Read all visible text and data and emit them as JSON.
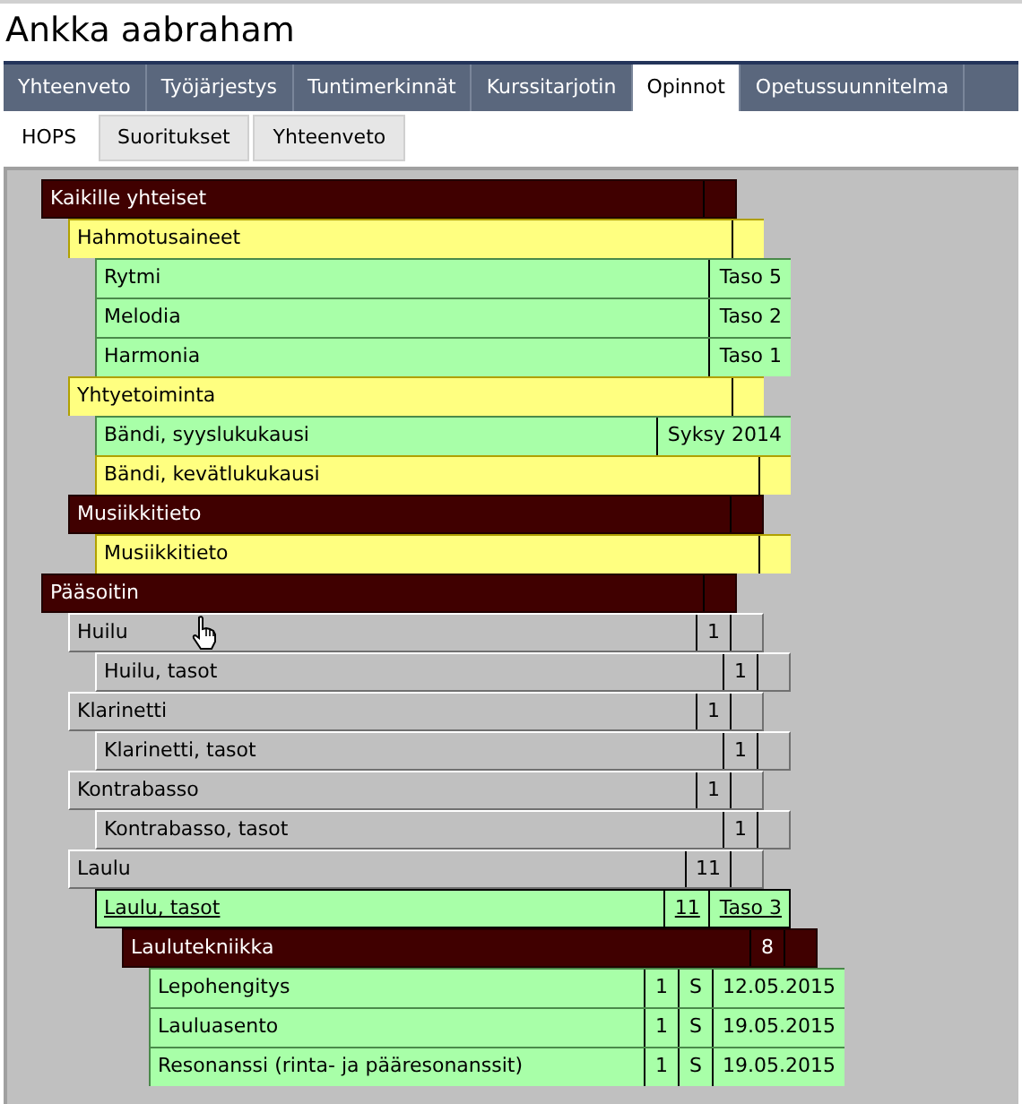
{
  "title": "Ankka aabraham",
  "tabs": [
    {
      "label": "Yhteenveto",
      "selected": false
    },
    {
      "label": "Työjärjestys",
      "selected": false
    },
    {
      "label": "Tuntimerkinnät",
      "selected": false
    },
    {
      "label": "Kurssitarjotin",
      "selected": false
    },
    {
      "label": "Opinnot",
      "selected": true
    },
    {
      "label": "Opetussuunnitelma",
      "selected": false
    }
  ],
  "subtabs": [
    {
      "label": "HOPS",
      "selected": true
    },
    {
      "label": "Suoritukset",
      "selected": false
    },
    {
      "label": "Yhteenveto",
      "selected": false
    }
  ],
  "tree": [
    {
      "label": "Kaikille yhteiset",
      "kind": "group",
      "selected": false,
      "children": [
        {
          "label": "Hahmotusaineet",
          "kind": "planned",
          "selected": false,
          "children": [
            {
              "label": "Rytmi",
              "kind": "done",
              "selected": false,
              "cells": [
                "Taso 5"
              ]
            },
            {
              "label": "Melodia",
              "kind": "done",
              "selected": false,
              "cells": [
                "Taso 2"
              ]
            },
            {
              "label": "Harmonia",
              "kind": "done",
              "selected": false,
              "cells": [
                "Taso 1"
              ]
            }
          ]
        },
        {
          "label": "Yhtyetoiminta",
          "kind": "planned",
          "selected": false,
          "children": [
            {
              "label": "Bändi, syyslukukausi",
              "kind": "done",
              "selected": false,
              "cells": [
                "Syksy 2014"
              ]
            },
            {
              "label": "Bändi, kevätlukukausi",
              "kind": "planned",
              "selected": false
            }
          ]
        },
        {
          "label": "Musiikkitieto",
          "kind": "group",
          "selected": false,
          "children": [
            {
              "label": "Musiikkitieto",
              "kind": "planned",
              "selected": false
            }
          ]
        }
      ]
    },
    {
      "label": "Pääsoitin",
      "kind": "group",
      "selected": false,
      "children": [
        {
          "label": "Huilu",
          "kind": "neutral",
          "selected": false,
          "cells": [
            "1"
          ],
          "children": [
            {
              "label": "Huilu, tasot",
              "kind": "neutral",
              "selected": false,
              "cells": [
                "1"
              ]
            }
          ]
        },
        {
          "label": "Klarinetti",
          "kind": "neutral",
          "selected": false,
          "cells": [
            "1"
          ],
          "children": [
            {
              "label": "Klarinetti, tasot",
              "kind": "neutral",
              "selected": false,
              "cells": [
                "1"
              ]
            }
          ]
        },
        {
          "label": "Kontrabasso",
          "kind": "neutral",
          "selected": false,
          "cells": [
            "1"
          ],
          "children": [
            {
              "label": "Kontrabasso, tasot",
              "kind": "neutral",
              "selected": false,
              "cells": [
                "1"
              ]
            }
          ]
        },
        {
          "label": "Laulu",
          "kind": "neutral",
          "selected": false,
          "cells": [
            "11"
          ],
          "children": [
            {
              "label": "Laulu, tasot",
              "kind": "done",
              "selected": true,
              "cells": [
                "11",
                "Taso 3"
              ],
              "children": [
                {
                  "label": "Laulutekniikka",
                  "kind": "group",
                  "selected": false,
                  "cells": [
                    "8"
                  ],
                  "children": [
                    {
                      "label": "Lepohengitys",
                      "kind": "done",
                      "selected": false,
                      "cells": [
                        "1",
                        "S",
                        "12.05.2015"
                      ]
                    },
                    {
                      "label": "Lauluasento",
                      "kind": "done",
                      "selected": false,
                      "cells": [
                        "1",
                        "S",
                        "19.05.2015"
                      ]
                    },
                    {
                      "label": "Resonanssi (rinta- ja pääresonanssit)",
                      "kind": "done",
                      "selected": false,
                      "cells": [
                        "1",
                        "S",
                        "19.05.2015"
                      ]
                    }
                  ]
                }
              ]
            }
          ]
        }
      ]
    }
  ]
}
